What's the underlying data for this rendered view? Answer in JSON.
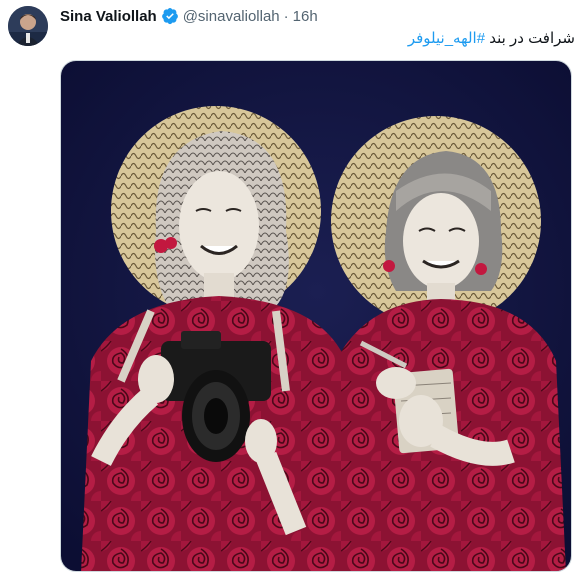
{
  "tweet": {
    "author_name": "Sina Valiollah",
    "handle": "@sinavaliollah",
    "separator": "·",
    "timestamp": "16h",
    "text_prefix": "شرافت در بند ",
    "hashtag": "#الهه_نیلوفر",
    "avatar_icon": "profile-photo",
    "verified_icon": "verified-badge-icon",
    "colors": {
      "verified": "#1d9bf0",
      "link": "#1d9bf0",
      "secondary_text": "#536471"
    }
  },
  "media": {
    "description_icon": "illustration-two-women-with-roses",
    "background_color": "#12153f",
    "rose_color": "#a0183c"
  }
}
